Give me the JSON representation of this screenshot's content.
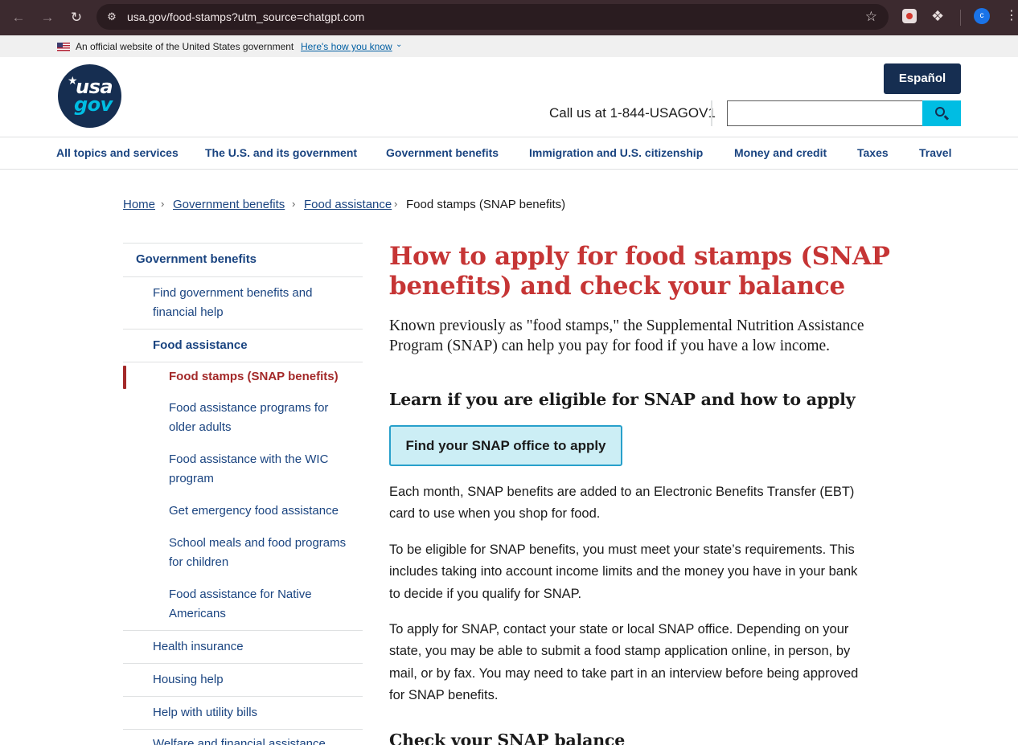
{
  "browser": {
    "url": "usa.gov/food-stamps?utm_source=chatgpt.com",
    "profile_initial": "c"
  },
  "banner": {
    "official_text": "An official website of the United States government",
    "how_you_know": "Here's how you know"
  },
  "header": {
    "logo_text_top": "usa",
    "logo_text_bottom": "gov",
    "espanol_label": "Español",
    "call_us": "Call us at 1-844-USAGOV1",
    "search_placeholder": ""
  },
  "nav": {
    "items": [
      "All topics and services",
      "The U.S. and its government",
      "Government benefits",
      "Immigration and U.S. citizenship",
      "Money and credit",
      "Taxes",
      "Travel"
    ]
  },
  "breadcrumb": {
    "links": [
      "Home",
      "Government benefits",
      "Food assistance"
    ],
    "current": "Food stamps (SNAP benefits)"
  },
  "sidebar": {
    "heading": "Government benefits",
    "items": [
      {
        "label": "Find government benefits and financial help",
        "level": 1
      },
      {
        "label": "Food assistance",
        "level": 1,
        "expanded": true
      },
      {
        "label": "Food stamps (SNAP benefits)",
        "level": 2,
        "current": true
      },
      {
        "label": "Food assistance programs for older adults",
        "level": 2
      },
      {
        "label": "Food assistance with the WIC program",
        "level": 2
      },
      {
        "label": "Get emergency food assistance",
        "level": 2
      },
      {
        "label": "School meals and food programs for children",
        "level": 2
      },
      {
        "label": "Food assistance for Native Americans",
        "level": 2
      },
      {
        "label": "Health insurance",
        "level": 1
      },
      {
        "label": "Housing help",
        "level": 1
      },
      {
        "label": "Help with utility bills",
        "level": 1
      },
      {
        "label": "Welfare and financial assistance",
        "level": 1
      }
    ]
  },
  "main": {
    "title": "How to apply for food stamps (SNAP benefits) and check your balance",
    "lead": "Known previously as \"food stamps,\" the Supplemental Nutrition Assistance Program (SNAP) can help you pay for food if you have a low income.",
    "section1_heading": "Learn if you are eligible for SNAP and how to apply",
    "cta_label": "Find your SNAP office to apply",
    "paragraphs": [
      "Each month, SNAP benefits are added to an Electronic Benefits Transfer (EBT) card to use when you shop for food.",
      "To be eligible for SNAP benefits, you must meet your state’s requirements. This includes taking into account income limits and the money you have in your bank to decide if you qualify for SNAP.",
      "To apply for SNAP, contact your state or local SNAP office. Depending on your state, you may be able to submit a food stamp application online, in person, by mail, or by fax. You may need to take part in an interview before being approved for SNAP benefits."
    ],
    "section2_heading": "Check your SNAP balance"
  },
  "colors": {
    "title_red": "#c63535",
    "nav_blue": "#1a4480",
    "header_navy": "#162e51",
    "accent_cyan": "#00bde3",
    "current_red": "#a32929"
  }
}
